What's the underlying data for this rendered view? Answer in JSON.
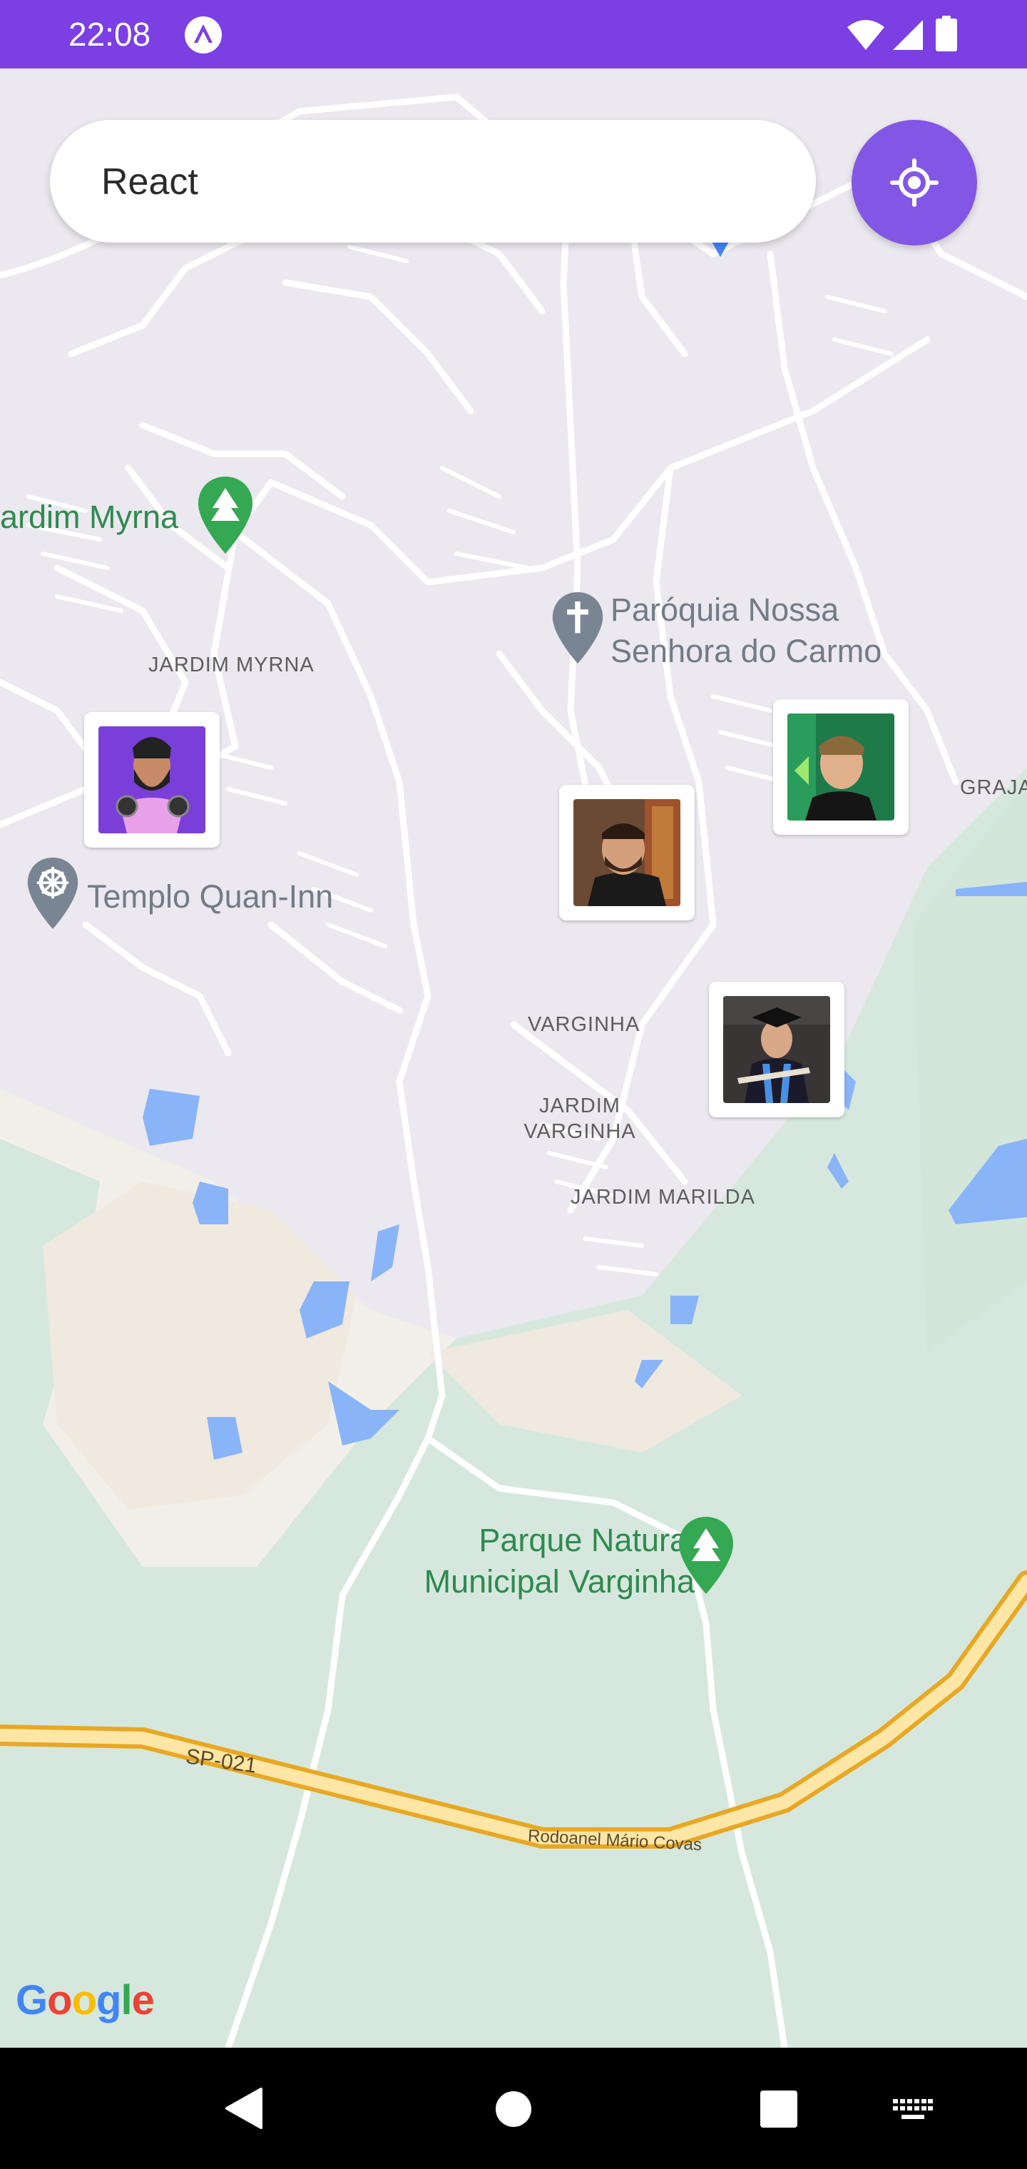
{
  "status_bar": {
    "time": "22:08",
    "icons": [
      "expo-icon",
      "wifi-icon",
      "signal-icon",
      "battery-icon"
    ]
  },
  "search": {
    "value": "React",
    "placeholder": ""
  },
  "locate_button": {
    "icon": "crosshair-icon",
    "color": "#8257e5"
  },
  "map": {
    "neighborhoods": [
      "JARDIM MYRNA",
      "VARGINHA",
      "JARDIM VARGINHA",
      "JARDIM MARILDA",
      "GRAJA"
    ],
    "places": {
      "jardim_myrna_park": "ardim Myrna",
      "parish": "Paróquia Nossa Senhora do Carmo",
      "temple": "Templo Quan-Inn",
      "park": "Parque Natural Municipal Varginha"
    },
    "roads": {
      "sp021": "SP-021",
      "rodoanel": "Rodoanel Mário Covas"
    },
    "colors": {
      "urban": "#ebe8ef",
      "land": "#f2efe9",
      "green": "#d6e8dd",
      "water": "#8ab4f8",
      "highway": "#f9c74f",
      "accent": "#7b3fe4"
    }
  },
  "markers": [
    {
      "name": "dev-avatar-illustrated"
    },
    {
      "name": "dev-avatar-selfie"
    },
    {
      "name": "dev-avatar-green"
    },
    {
      "name": "dev-avatar-graduate"
    }
  ],
  "attribution": {
    "google": [
      "G",
      "o",
      "o",
      "g",
      "l",
      "e"
    ]
  },
  "nav_bar": {
    "icons": [
      "back-icon",
      "home-icon",
      "recents-icon",
      "keyboard-icon"
    ]
  }
}
